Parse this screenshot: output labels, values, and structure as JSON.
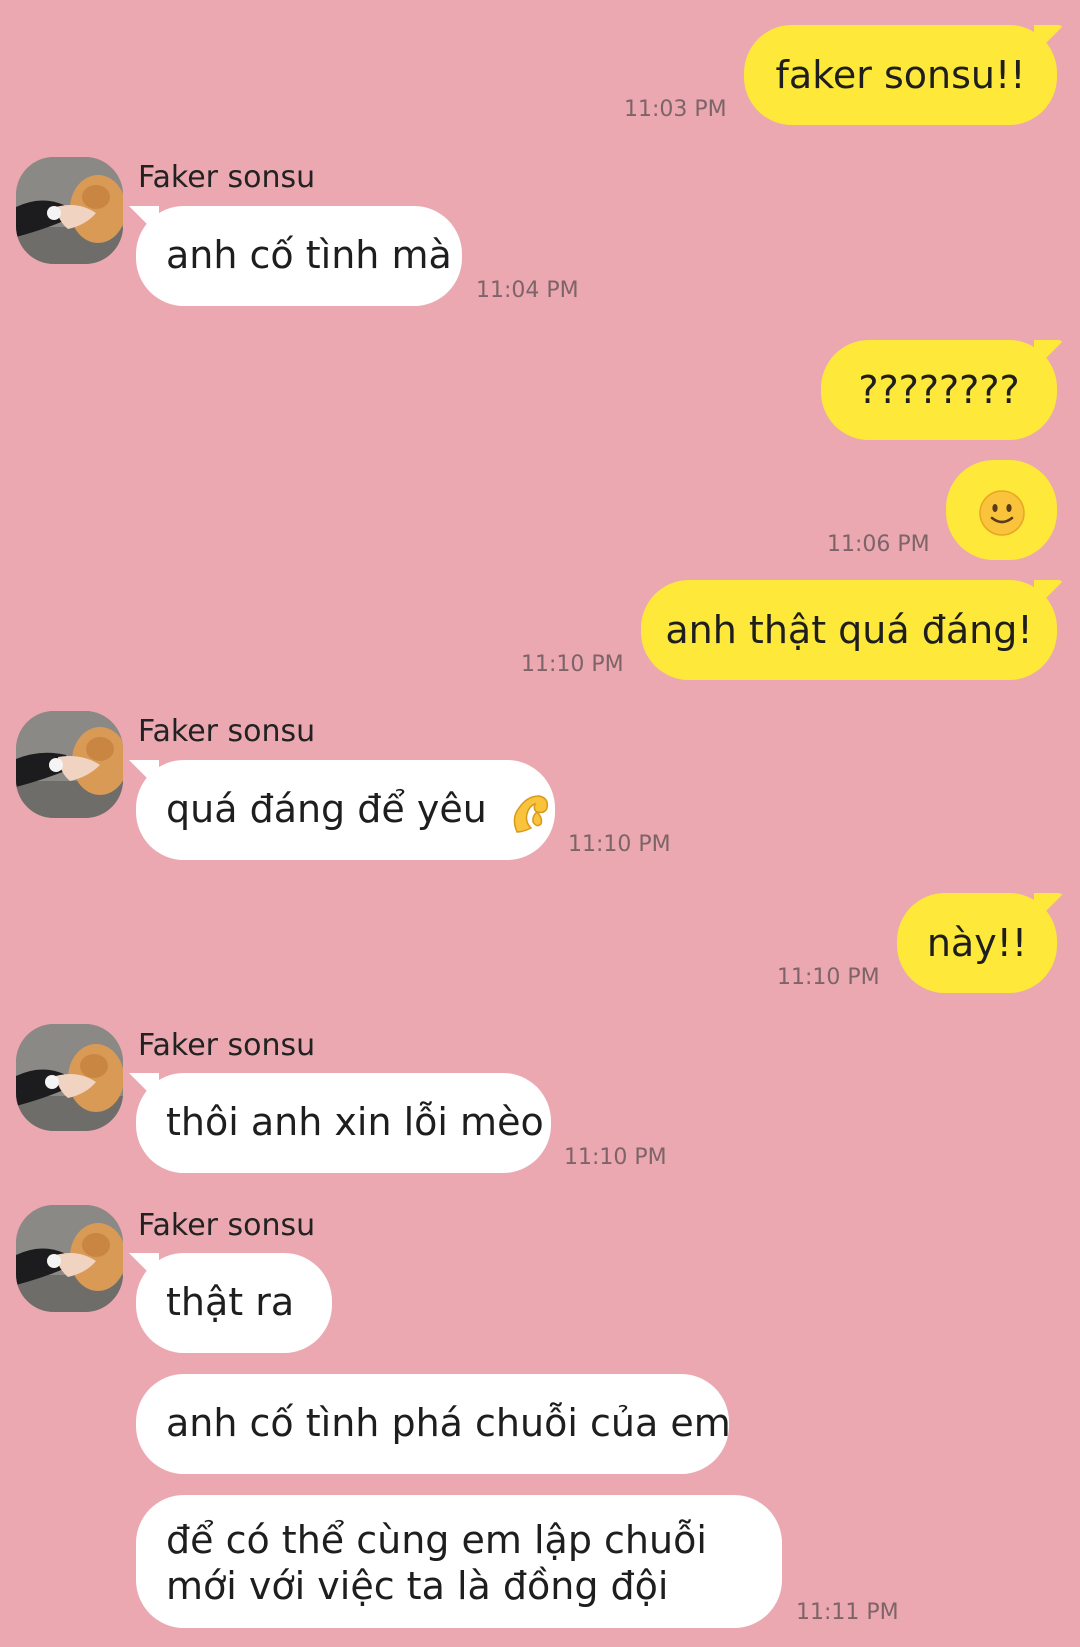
{
  "contact": {
    "name": "Faker sonsu"
  },
  "messages": [
    {
      "sender": "me",
      "text": "faker sonsu!!",
      "time": "11:03 PM"
    },
    {
      "sender": "them",
      "text": "anh cố tình mà",
      "time": "11:04 PM"
    },
    {
      "sender": "me",
      "text": "????????"
    },
    {
      "sender": "me",
      "emoji": "slightly-smiling-face-emoji",
      "time": "11:06 PM"
    },
    {
      "sender": "me",
      "text": "anh thật quá đáng!",
      "time": "11:10 PM"
    },
    {
      "sender": "them",
      "text": "quá đáng để yêu",
      "emoji": "pinching-hand-emoji",
      "time": "11:10 PM"
    },
    {
      "sender": "me",
      "text": "này!!",
      "time": "11:10 PM"
    },
    {
      "sender": "them",
      "text": "thôi anh xin lỗi mèo",
      "time": "11:10 PM"
    },
    {
      "sender": "them",
      "text": "thật ra"
    },
    {
      "sender": "them",
      "text": "anh cố tình phá chuỗi của em"
    },
    {
      "sender": "them",
      "text": "để có thể cùng em lập chuỗi mới với việc ta là đồng đội",
      "time": "11:11 PM"
    }
  ],
  "colors": {
    "background": "#EBA8B1",
    "my_bubble": "#FEE83A",
    "their_bubble": "#FFFFFF",
    "timestamp": "#7d6468"
  }
}
